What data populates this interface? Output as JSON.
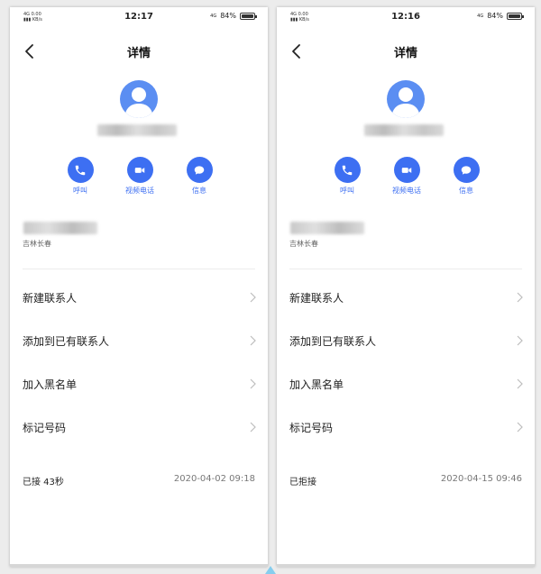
{
  "colors": {
    "accent": "#3d6ff2",
    "avatar": "#5b8ef2",
    "background": "#ececec"
  },
  "screens": [
    {
      "status": {
        "network": "4G",
        "speed": "0.00",
        "speed_unit": "KB/s",
        "time": "12:17",
        "net2": "4G",
        "battery": "84%",
        "battery_level": 0.84
      },
      "header": {
        "title": "详情",
        "back_icon": "chevron-left-icon"
      },
      "actions": [
        {
          "label": "呼叫",
          "icon": "phone-icon"
        },
        {
          "label": "视频电话",
          "icon": "video-camera-icon"
        },
        {
          "label": "信息",
          "icon": "message-bubble-icon"
        }
      ],
      "location": "吉林长春",
      "menu": [
        {
          "label": "新建联系人"
        },
        {
          "label": "添加到已有联系人"
        },
        {
          "label": "加入黑名单"
        },
        {
          "label": "标记号码"
        }
      ],
      "call": {
        "state": "已接 43秒",
        "datetime": "2020-04-02 09:18"
      }
    },
    {
      "status": {
        "network": "4G",
        "speed": "0.00",
        "speed_unit": "KB/s",
        "time": "12:16",
        "net2": "4G",
        "battery": "84%",
        "battery_level": 0.84
      },
      "header": {
        "title": "详情",
        "back_icon": "chevron-left-icon"
      },
      "actions": [
        {
          "label": "呼叫",
          "icon": "phone-icon"
        },
        {
          "label": "视频电话",
          "icon": "video-camera-icon"
        },
        {
          "label": "信息",
          "icon": "message-bubble-icon"
        }
      ],
      "location": "吉林长春",
      "menu": [
        {
          "label": "新建联系人"
        },
        {
          "label": "添加到已有联系人"
        },
        {
          "label": "加入黑名单"
        },
        {
          "label": "标记号码"
        }
      ],
      "call": {
        "state": "已拒接",
        "datetime": "2020-04-15 09:46"
      }
    }
  ]
}
